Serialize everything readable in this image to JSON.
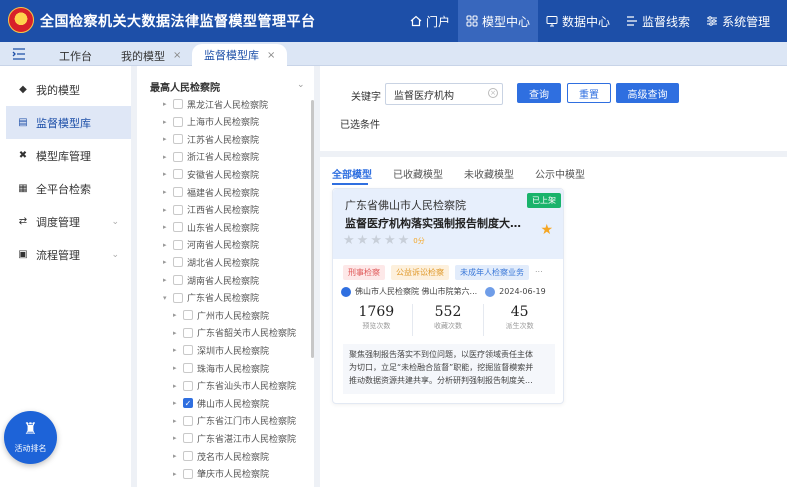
{
  "app": {
    "title": "全国检察机关大数据法律监督模型管理平台"
  },
  "topnav": [
    {
      "label": "门户",
      "icon": "home-icon"
    },
    {
      "label": "模型中心",
      "icon": "grid-icon",
      "active": true
    },
    {
      "label": "数据中心",
      "icon": "monitor-icon"
    },
    {
      "label": "监督线索",
      "icon": "flow-icon"
    },
    {
      "label": "系统管理",
      "icon": "settings-icon"
    }
  ],
  "tabs": {
    "workbench": "工作台",
    "my_models": "我的模型",
    "model_library": "监督模型库",
    "close": "×"
  },
  "sidebar": {
    "items": [
      {
        "label": "我的模型",
        "icon": "cube-icon"
      },
      {
        "label": "监督模型库",
        "icon": "library-icon",
        "active": true
      },
      {
        "label": "模型库管理",
        "icon": "tools-icon"
      },
      {
        "label": "全平台检索",
        "icon": "search-doc-icon"
      },
      {
        "label": "调度管理",
        "icon": "dispatch-icon",
        "expandable": true
      },
      {
        "label": "流程管理",
        "icon": "flow-doc-icon",
        "expandable": true
      }
    ],
    "fab_label": "活动排名"
  },
  "tree": {
    "root": "最高人民检察院",
    "provinces": [
      "黑龙江省人民检察院",
      "上海市人民检察院",
      "江苏省人民检察院",
      "浙江省人民检察院",
      "安徽省人民检察院",
      "福建省人民检察院",
      "江西省人民检察院",
      "山东省人民检察院",
      "河南省人民检察院",
      "湖北省人民检察院",
      "湖南省人民检察院",
      "广东省人民检察院"
    ],
    "cities": [
      {
        "label": "广州市人民检察院",
        "checked": false
      },
      {
        "label": "广东省韶关市人民检察院",
        "checked": false
      },
      {
        "label": "深圳市人民检察院",
        "checked": false
      },
      {
        "label": "珠海市人民检察院",
        "checked": false
      },
      {
        "label": "广东省汕头市人民检察院",
        "checked": false
      },
      {
        "label": "佛山市人民检察院",
        "checked": true
      },
      {
        "label": "广东省江门市人民检察院",
        "checked": false
      },
      {
        "label": "广东省湛江市人民检察院",
        "checked": false
      },
      {
        "label": "茂名市人民检察院",
        "checked": false
      },
      {
        "label": "肇庆市人民检察院",
        "checked": false
      }
    ]
  },
  "search": {
    "keyword_label": "关键字",
    "keyword_value": "监督医疗机构",
    "query_button": "查询",
    "reset_button": "重置",
    "advanced_button": "高级查询",
    "selected_label": "已选条件"
  },
  "subtabs": [
    "全部模型",
    "已收藏模型",
    "未收藏模型",
    "公示中模型"
  ],
  "card": {
    "org": "广东省佛山市人民检察院",
    "title": "监督医疗机构落实强制报告制度大数...",
    "badge": "已上架",
    "rating": 0,
    "score": "0分",
    "tags": [
      "刑事检察",
      "公益诉讼检察",
      "未成年人检察业务"
    ],
    "tag_more": "...",
    "owner": "佛山市人民检察院 佛山市院第六...",
    "date": "2024-06-19",
    "stats": [
      {
        "value": "1769",
        "label": "预览次数"
      },
      {
        "value": "552",
        "label": "收藏次数"
      },
      {
        "value": "45",
        "label": "派生次数"
      }
    ],
    "description": [
      "聚焦强制报告落实不到位问题，以医疗领域责任主体",
      "为切口，立足“未检融合监督”职能，挖掘监督模索并",
      "推动数据资源共建共享。分析研判强制报告制度关..."
    ]
  }
}
